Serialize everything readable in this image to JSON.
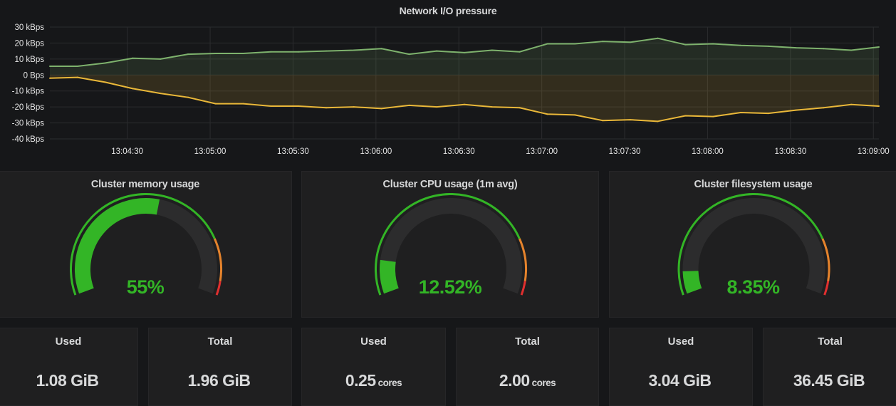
{
  "network_panel": {
    "title": "Network I/O pressure"
  },
  "chart_data": {
    "type": "line",
    "title": "Network I/O pressure",
    "y_ticks": [
      "30 kBps",
      "20 kBps",
      "10 kBps",
      "0 Bps",
      "-10 kBps",
      "-20 kBps",
      "-30 kBps",
      "-40 kBps"
    ],
    "y_tick_values": [
      30,
      20,
      10,
      0,
      -10,
      -20,
      -30,
      -40
    ],
    "x_ticks": [
      "13:04:30",
      "13:05:00",
      "13:05:30",
      "13:06:00",
      "13:06:30",
      "13:07:00",
      "13:07:30",
      "13:08:00",
      "13:08:30",
      "13:09:00"
    ],
    "ylim": [
      -40,
      30
    ],
    "x_unit": "seconds after 13:04:00",
    "xlim": [
      2,
      302
    ],
    "grid": true,
    "series": [
      {
        "color": "#7eb26d",
        "x": [
          2,
          12,
          22,
          32,
          42,
          52,
          62,
          72,
          82,
          92,
          102,
          112,
          122,
          132,
          142,
          152,
          162,
          172,
          182,
          192,
          202,
          212,
          222,
          232,
          242,
          252,
          262,
          272,
          282,
          292,
          302
        ],
        "values": [
          5.5,
          5.5,
          7.5,
          10.5,
          10,
          13,
          13.5,
          13.5,
          14.5,
          14.5,
          15,
          15.5,
          16.5,
          13,
          15,
          14,
          15.5,
          14.5,
          19.5,
          19.5,
          21,
          20.5,
          23,
          19,
          19.5,
          18.5,
          18,
          17,
          16.5,
          15.5,
          17.5
        ]
      },
      {
        "color": "#eab839",
        "x": [
          2,
          12,
          22,
          32,
          42,
          52,
          62,
          72,
          82,
          92,
          102,
          112,
          122,
          132,
          142,
          152,
          162,
          172,
          182,
          192,
          202,
          212,
          222,
          232,
          242,
          252,
          262,
          272,
          282,
          292,
          302
        ],
        "values": [
          -2,
          -1.5,
          -4.5,
          -8.5,
          -11.5,
          -14,
          -18,
          -18,
          -19.5,
          -19.5,
          -20.5,
          -20,
          -21,
          -19,
          -20,
          -18.5,
          -20,
          -20.5,
          -24.5,
          -25,
          -28.5,
          -28,
          -29,
          -25.5,
          -26,
          -23.5,
          -24,
          -22,
          -20.5,
          -18.5,
          -19.5
        ]
      }
    ]
  },
  "gauges": [
    {
      "title": "Cluster memory usage",
      "value_text": "55%",
      "value": 55,
      "thresholds": [
        80,
        95
      ]
    },
    {
      "title": "Cluster CPU usage (1m avg)",
      "value_text": "12.52%",
      "value": 12.52,
      "thresholds": [
        80,
        95
      ]
    },
    {
      "title": "Cluster filesystem usage",
      "value_text": "8.35%",
      "value": 8.35,
      "thresholds": [
        80,
        95
      ]
    }
  ],
  "stats": [
    {
      "label": "Used",
      "value": "1.08 GiB",
      "unit": ""
    },
    {
      "label": "Total",
      "value": "1.96 GiB",
      "unit": ""
    },
    {
      "label": "Used",
      "value": "0.25",
      "unit": "cores"
    },
    {
      "label": "Total",
      "value": "2.00",
      "unit": "cores"
    },
    {
      "label": "Used",
      "value": "3.04 GiB",
      "unit": ""
    },
    {
      "label": "Total",
      "value": "36.45 GiB",
      "unit": ""
    }
  ],
  "colors": {
    "background": "#161719",
    "panel": "#1f1f20",
    "gauge_ok": "#33b526",
    "gauge_warn": "#e5832c",
    "gauge_crit": "#e02f2f",
    "gauge_track": "#2c2c2d",
    "text": "#d8d9da"
  }
}
